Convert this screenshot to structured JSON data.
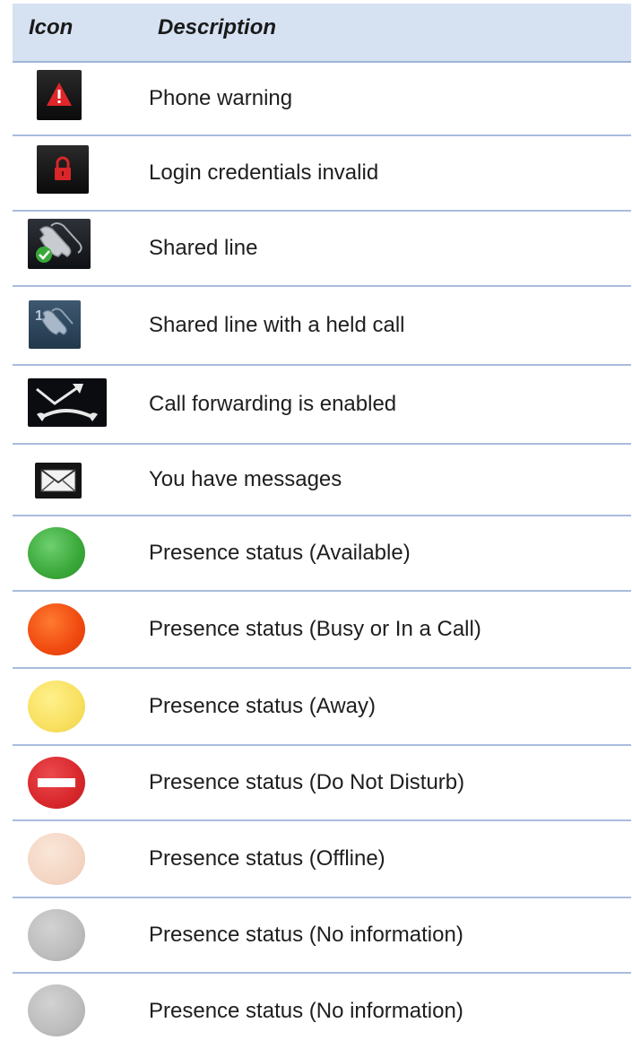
{
  "header": {
    "icon_label": "Icon",
    "description_label": "Description"
  },
  "rows": [
    {
      "icon": "phone-warning-icon",
      "description": "Phone warning"
    },
    {
      "icon": "lock-icon",
      "description": "Login credentials invalid"
    },
    {
      "icon": "shared-line-icon",
      "description": "Shared line"
    },
    {
      "icon": "shared-line-held-call-icon",
      "description": "Shared line with a held call"
    },
    {
      "icon": "call-forwarding-icon",
      "description": "Call forwarding is enabled"
    },
    {
      "icon": "envelope-icon",
      "description": "You have messages"
    },
    {
      "icon": "presence-available-icon",
      "description": "Presence status (Available)",
      "color": "#3fb23f"
    },
    {
      "icon": "presence-busy-icon",
      "description": "Presence status (Busy or In a Call)",
      "color": "#f04010"
    },
    {
      "icon": "presence-away-icon",
      "description": "Presence status (Away)",
      "color": "#f8e060"
    },
    {
      "icon": "presence-dnd-icon",
      "description": "Presence status (Do Not Disturb)",
      "color": "#d8282c"
    },
    {
      "icon": "presence-offline-icon",
      "description": "Presence status (Offline)",
      "color": "#f4d6c4"
    },
    {
      "icon": "presence-no-info-icon",
      "description": "Presence status (No information)",
      "color": "#bdbdbd"
    },
    {
      "icon": "presence-no-info-icon",
      "description": "Presence status (No information)",
      "color": "#bdbdbd"
    }
  ]
}
